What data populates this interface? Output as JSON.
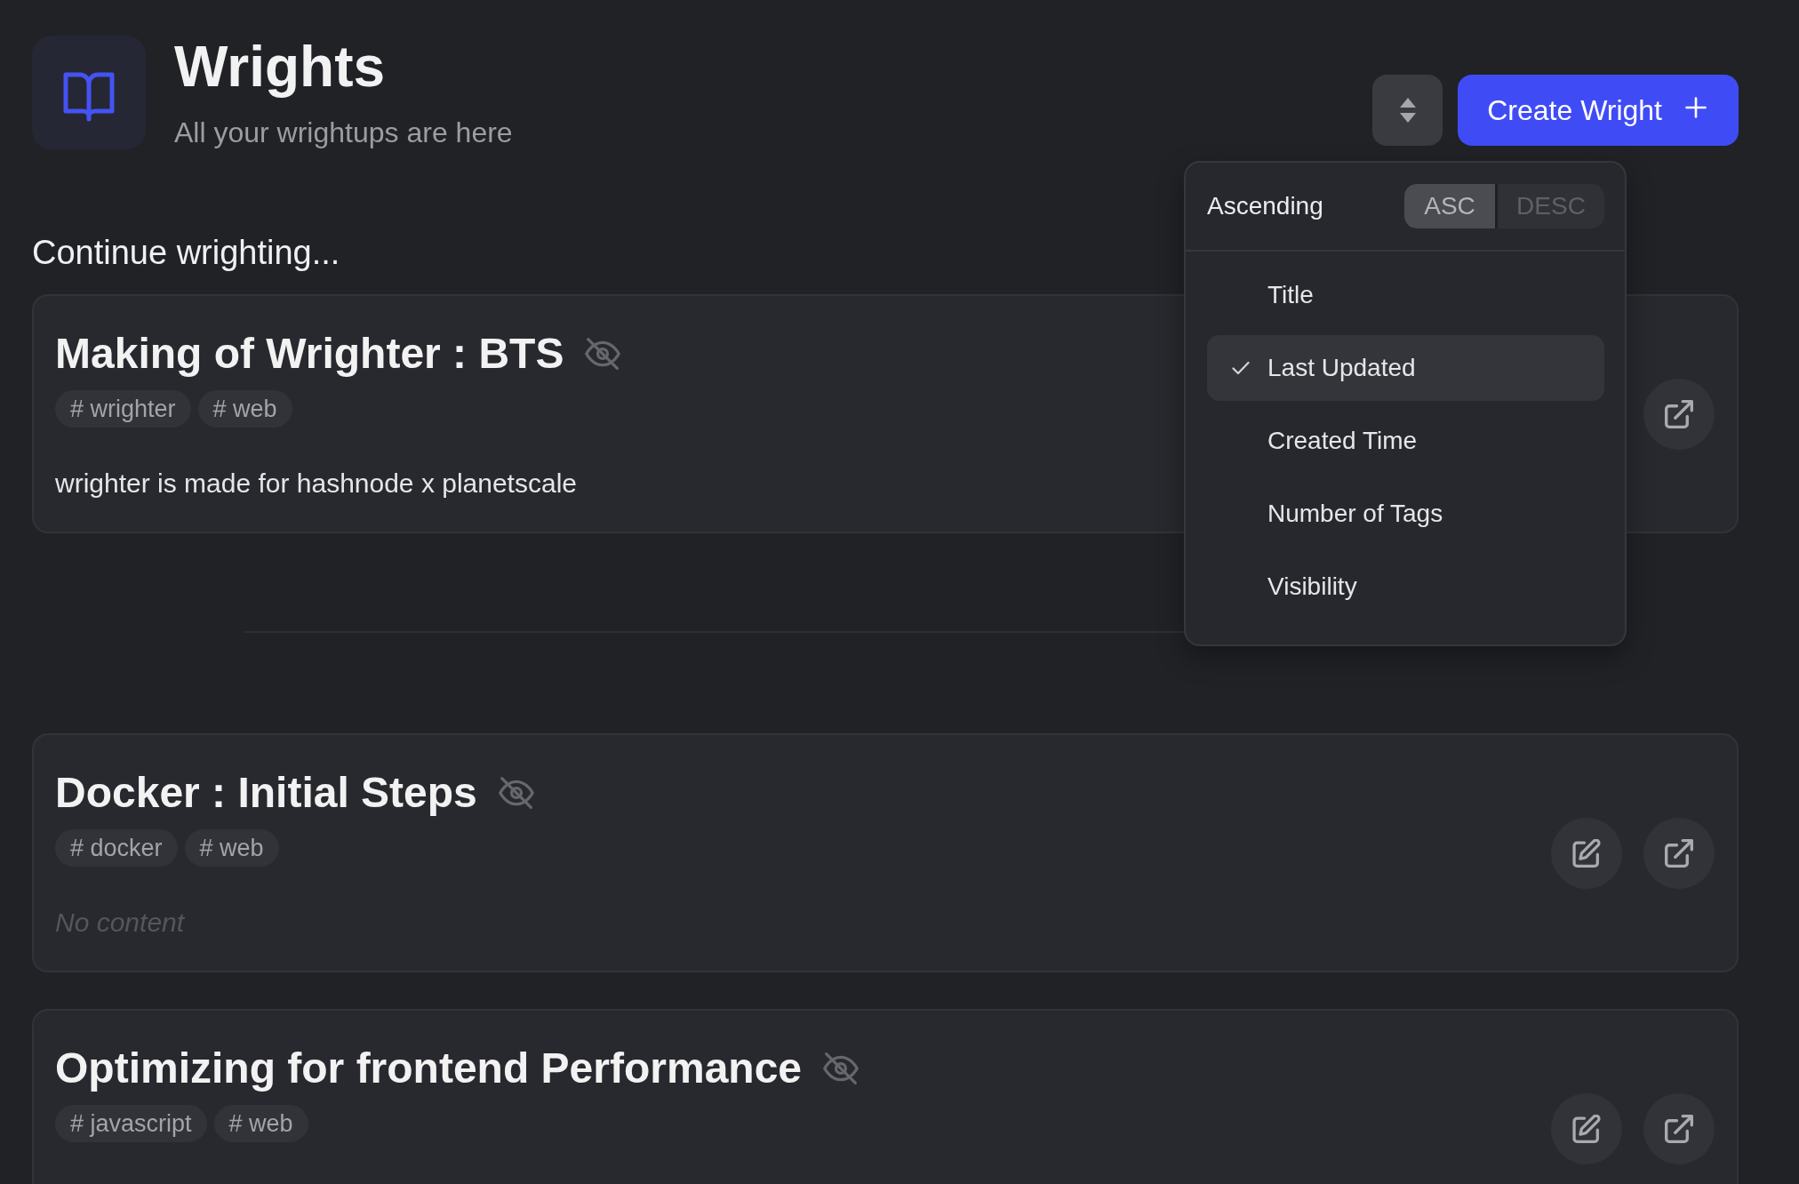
{
  "header": {
    "title": "Wrights",
    "subtitle": "All your wrightups are here",
    "create_button": "Create Wright"
  },
  "sort_menu": {
    "direction_label": "Ascending",
    "directions": [
      {
        "label": "ASC",
        "selected": true
      },
      {
        "label": "DESC",
        "selected": false
      }
    ],
    "fields": [
      {
        "label": "Title",
        "selected": false
      },
      {
        "label": "Last Updated",
        "selected": true
      },
      {
        "label": "Created Time",
        "selected": false
      },
      {
        "label": "Number of Tags",
        "selected": false
      },
      {
        "label": "Visibility",
        "selected": false
      }
    ]
  },
  "continue_section": {
    "heading": "Continue wrighting...",
    "cards": [
      {
        "title": "Making of Wrighter : BTS",
        "visible": false,
        "tags": [
          "# wrighter",
          "# web"
        ],
        "content": {
          "kind": "text",
          "text": "wrighter is made for hashnode x planetscale"
        },
        "actions": [
          {
            "kind": "open"
          }
        ]
      }
    ]
  },
  "wrights": [
    {
      "title": "Docker : Initial Steps",
      "visible": false,
      "tags": [
        "# docker",
        "# web"
      ],
      "content": {
        "kind": "empty",
        "text": "No content"
      },
      "actions": [
        {
          "kind": "edit"
        },
        {
          "kind": "open"
        }
      ]
    },
    {
      "title": "Optimizing for frontend Performance",
      "visible": false,
      "tags": [
        "# javascript",
        "# web"
      ],
      "actions": [
        {
          "kind": "edit"
        },
        {
          "kind": "open"
        }
      ]
    }
  ]
}
